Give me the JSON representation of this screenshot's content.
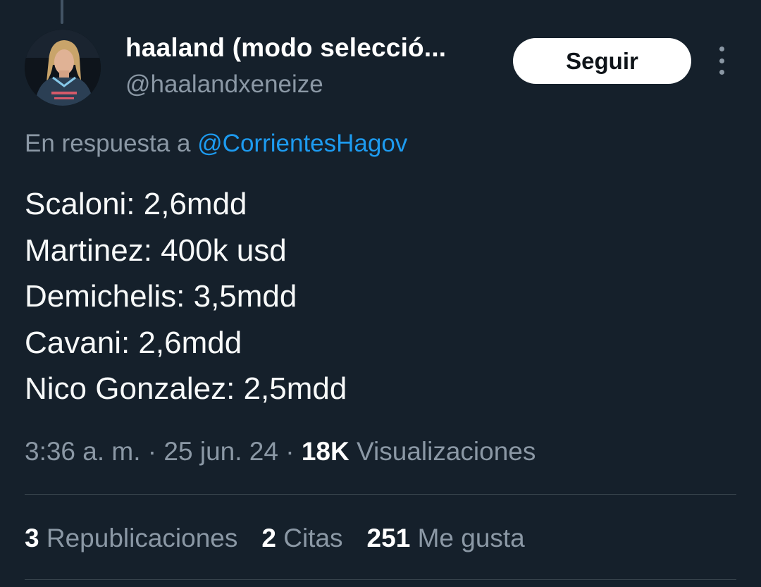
{
  "author": {
    "name": "haaland (modo selecció...",
    "handle": "@haalandxeneize"
  },
  "follow_label": "Seguir",
  "reply": {
    "prefix": "En respuesta a ",
    "mention": "@CorrientesHagov"
  },
  "tweet": {
    "lines": [
      "Scaloni: 2,6mdd",
      "Martinez: 400k usd",
      "Demichelis: 3,5mdd",
      "Cavani: 2,6mdd",
      "Nico Gonzalez: 2,5mdd"
    ]
  },
  "meta": {
    "time": "3:36 a. m.",
    "separator": " · ",
    "date": "25 jun. 24",
    "views_count": "18K",
    "views_label": "Visualizaciones"
  },
  "stats": [
    {
      "count": "3",
      "label": "Republicaciones"
    },
    {
      "count": "2",
      "label": "Citas"
    },
    {
      "count": "251",
      "label": "Me gusta"
    }
  ],
  "icons": {
    "more": "more-vertical-icon"
  },
  "colors": {
    "background": "#15202b",
    "link": "#1d9bf0",
    "muted": "#8b98a5",
    "button_bg": "#ffffff"
  }
}
